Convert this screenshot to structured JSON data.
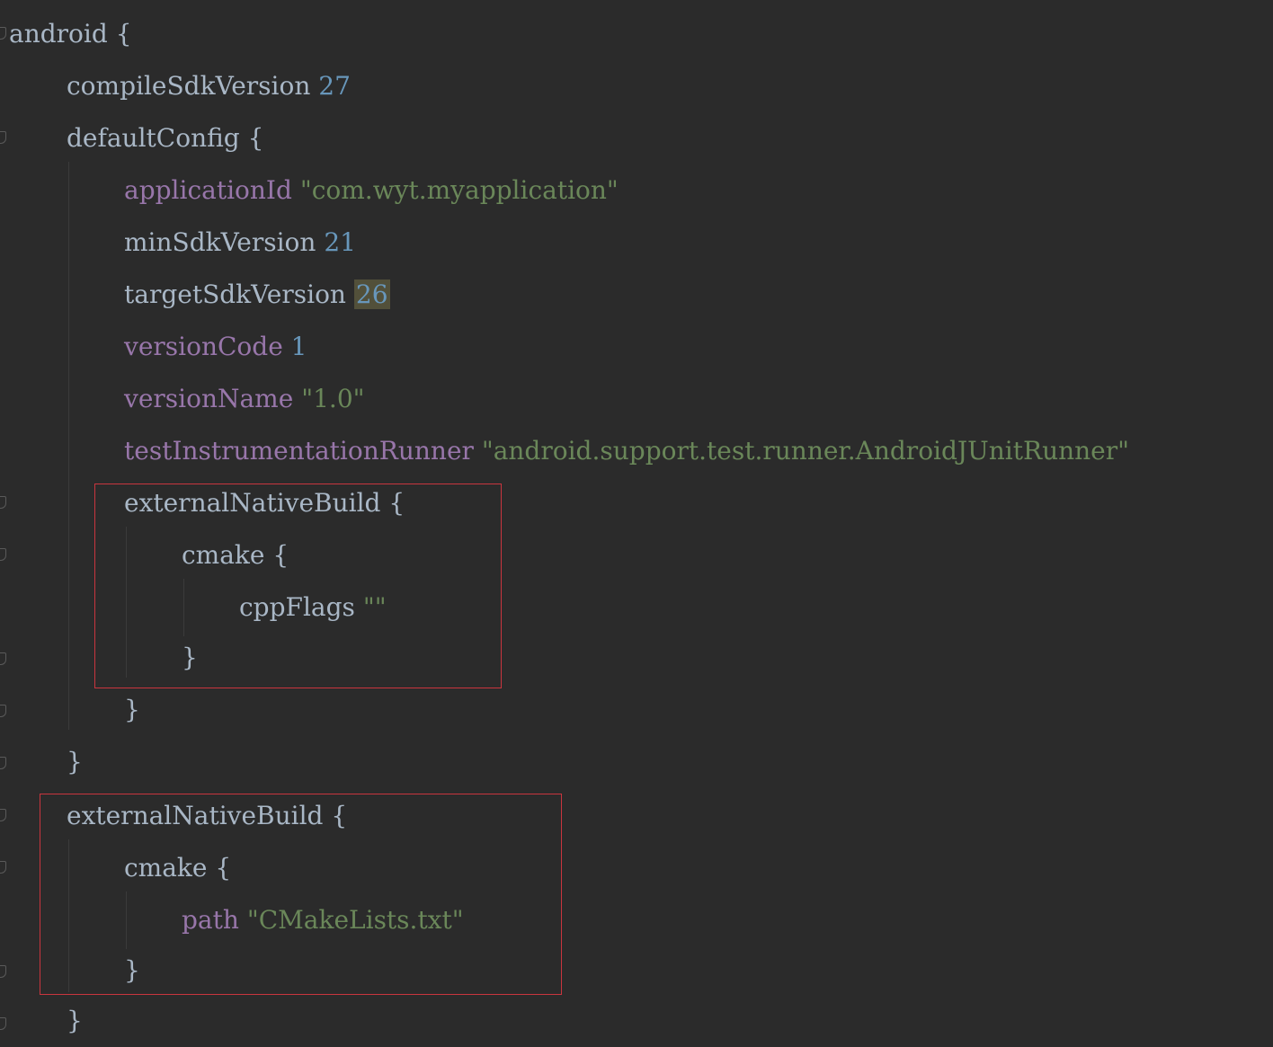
{
  "colors": {
    "background": "#2b2b2b",
    "plain_text": "#a9b7c6",
    "property": "#9876aa",
    "number": "#6897bb",
    "string": "#6a8759",
    "annotation_box": "#c9353e",
    "caret_highlight": "#52503a"
  },
  "code": {
    "l01": {
      "name": "android",
      "brace": "{"
    },
    "l02": {
      "name": "compileSdkVersion",
      "value": "27"
    },
    "l03": {
      "name": "defaultConfig",
      "brace": "{"
    },
    "l04": {
      "name": "applicationId",
      "value": "\"com.wyt.myapplication\""
    },
    "l05": {
      "name": "minSdkVersion",
      "value": "21"
    },
    "l06": {
      "name": "targetSdkVersion",
      "value": "26"
    },
    "l07": {
      "name": "versionCode",
      "value": "1"
    },
    "l08": {
      "name": "versionName",
      "value": "\"1.0\""
    },
    "l09": {
      "name": "testInstrumentationRunner",
      "value": "\"android.support.test.runner.AndroidJUnitRunner\""
    },
    "l10": {
      "name": "externalNativeBuild",
      "brace": "{"
    },
    "l11": {
      "name": "cmake",
      "brace": "{"
    },
    "l12": {
      "name": "cppFlags",
      "value": "\"\""
    },
    "l13": {
      "brace": "}"
    },
    "l14": {
      "brace": "}"
    },
    "l15": {
      "brace": "}"
    },
    "l16": {
      "name": "externalNativeBuild",
      "brace": "{"
    },
    "l17": {
      "name": "cmake",
      "brace": "{"
    },
    "l18": {
      "name": "path",
      "value": "\"CMakeLists.txt\""
    },
    "l19": {
      "brace": "}"
    },
    "l20": {
      "brace": "}"
    }
  }
}
